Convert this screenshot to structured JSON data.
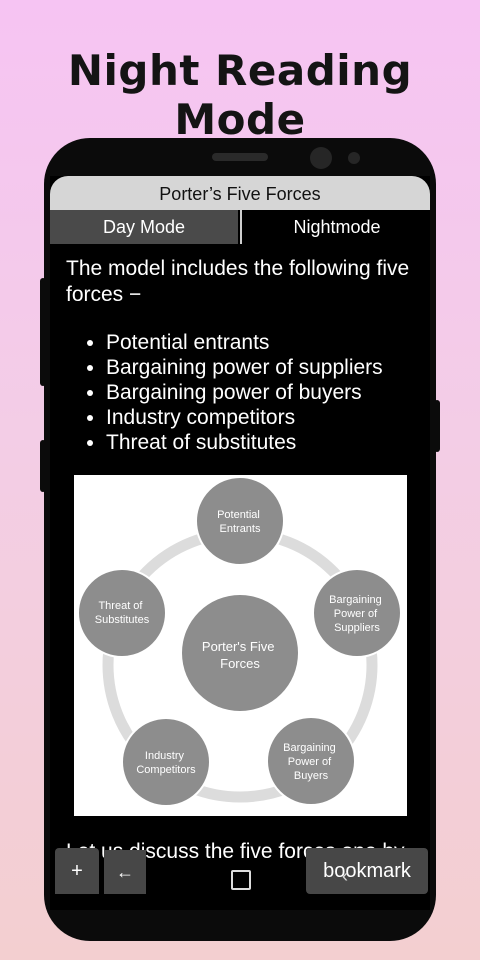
{
  "promo": {
    "headline": "Night Reading Mode"
  },
  "app": {
    "title": "Porter’s Five Forces",
    "tabs": [
      {
        "label": "Day Mode"
      },
      {
        "label": "Nightmode"
      }
    ]
  },
  "content": {
    "intro": "The model includes the following five forces −",
    "list": [
      "Potential entrants",
      "Bargaining power of suppliers",
      "Bargaining power of buyers",
      "Industry competitors",
      "Threat of substitutes"
    ],
    "partial_text": "Let us discuss the five forces one by"
  },
  "diagram": {
    "center": [
      "Porter's Five",
      "Forces"
    ],
    "nodes": [
      {
        "lines": [
          "Potential",
          "Entrants"
        ]
      },
      {
        "lines": [
          "Bargaining",
          "Power of",
          "Suppliers"
        ]
      },
      {
        "lines": [
          "Bargaining",
          "Power of",
          "Buyers"
        ]
      },
      {
        "lines": [
          "Industry",
          "Competitors"
        ]
      },
      {
        "lines": [
          "Threat of",
          "Substitutes"
        ]
      }
    ]
  },
  "controls": {
    "plus_label": "+",
    "return_label": "←",
    "bookmark_label": "bookmark"
  }
}
